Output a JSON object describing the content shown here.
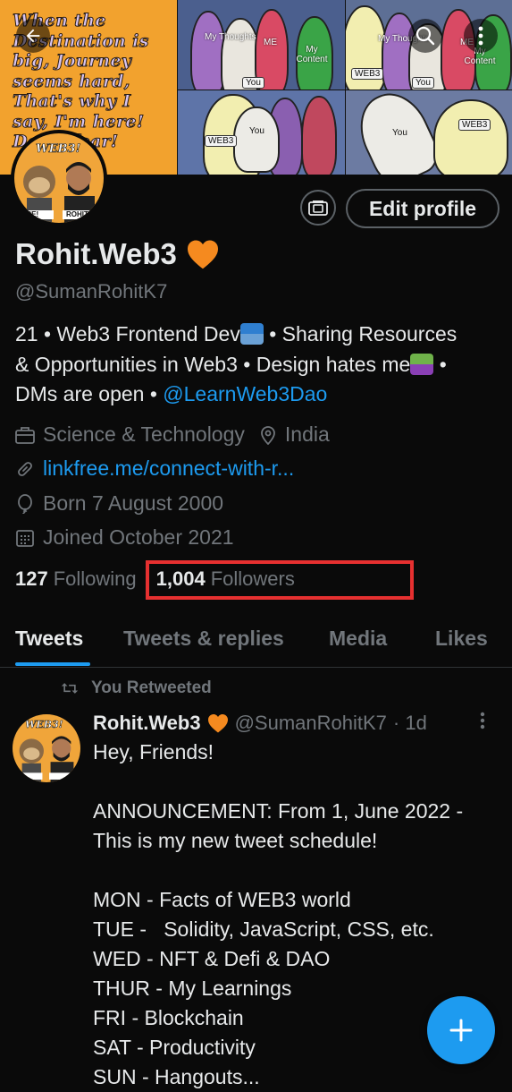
{
  "banner": {
    "quote_lines": [
      "When the",
      "Destination is",
      "big, Journey",
      "seems hard,",
      "That's why I",
      "say, I'm here!",
      "Don't fear!"
    ],
    "meme_labels": {
      "my_thoughts": "My Thoughts",
      "me": "ME",
      "my_content": "My Content",
      "you": "You",
      "web3": "WEB3"
    },
    "avatar_tag": "WEB3!",
    "avatar_caption_left": "APE!",
    "avatar_caption_right": "ROHIT"
  },
  "profile": {
    "edit_label": "Edit profile",
    "name": "Rohit.Web3",
    "handle": "@SumanRohitK7",
    "bio_line1": "21 • Web3 Frontend Dev",
    "bio_line1b": " • Sharing Resources",
    "bio_line2": "& Opportunities in Web3 •  Design hates me",
    "bio_line2b": " •",
    "bio_line3": "DMs are open •  ",
    "bio_mention": "@LearnWeb3Dao",
    "category": "Science & Technology",
    "location": "India",
    "website": "linkfree.me/connect-with-r...",
    "birthday": "Born 7 August 2000",
    "joined": "Joined October 2021",
    "following_count": "127",
    "following_label": "Following",
    "followers_count": "1,004",
    "followers_label": "Followers"
  },
  "tabs": [
    "Tweets",
    "Tweets & replies",
    "Media",
    "Likes"
  ],
  "tweet": {
    "retweet_label": "You Retweeted",
    "name": "Rohit.Web3",
    "handle": "@SumanRohitK7",
    "time": "· 1d",
    "lines": [
      "Hey, Friends!",
      "",
      "ANNOUNCEMENT: From 1, June 2022 -",
      "This is my new tweet schedule!",
      "",
      "MON - Facts of WEB3 world",
      "TUE -   Solidity, JavaScript, CSS, etc.",
      "WED - NFT & Defi & DAO",
      "THUR - My Learnings",
      "FRI - Blockchain",
      "SAT - Productivity",
      "SUN - Hangouts..."
    ]
  },
  "colors": {
    "accent": "#1d9bf0",
    "muted": "#71767b",
    "highlight": "#e63030",
    "heart": "#f58a1f"
  },
  "icons": [
    "back-arrow-icon",
    "search-icon",
    "more-vertical-icon",
    "camera-icon",
    "briefcase-icon",
    "location-pin-icon",
    "link-icon",
    "balloon-icon",
    "calendar-icon",
    "retweet-icon",
    "orange-heart-icon",
    "plus-icon"
  ]
}
